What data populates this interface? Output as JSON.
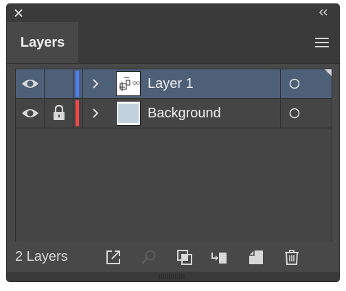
{
  "panel": {
    "tab_label": "Layers"
  },
  "layers": [
    {
      "name": "Layer 1",
      "color": "#4a7ef5",
      "selected": true,
      "locked": false
    },
    {
      "name": "Background",
      "color": "#f04646",
      "selected": false,
      "locked": true
    }
  ],
  "footer": {
    "layer_count": "2 Layers"
  },
  "colors": {
    "panel_bg": "#484848",
    "selected_row": "#4e6077",
    "icon": "#d8d8d8",
    "icon_disabled": "#5e5e5e"
  },
  "icons": {
    "close": "close-icon",
    "collapse": "double-chevron-left-icon",
    "menu": "hamburger-menu-icon",
    "visibility": "eye-icon",
    "lock": "lock-icon",
    "expand": "chevron-right-icon",
    "target": "circle-target-icon",
    "export": "export-icon",
    "locate": "search-icon",
    "clipping_mask": "clipping-mask-icon",
    "sublayer": "create-sublayer-icon",
    "new_layer": "new-layer-icon",
    "delete": "trash-icon"
  }
}
